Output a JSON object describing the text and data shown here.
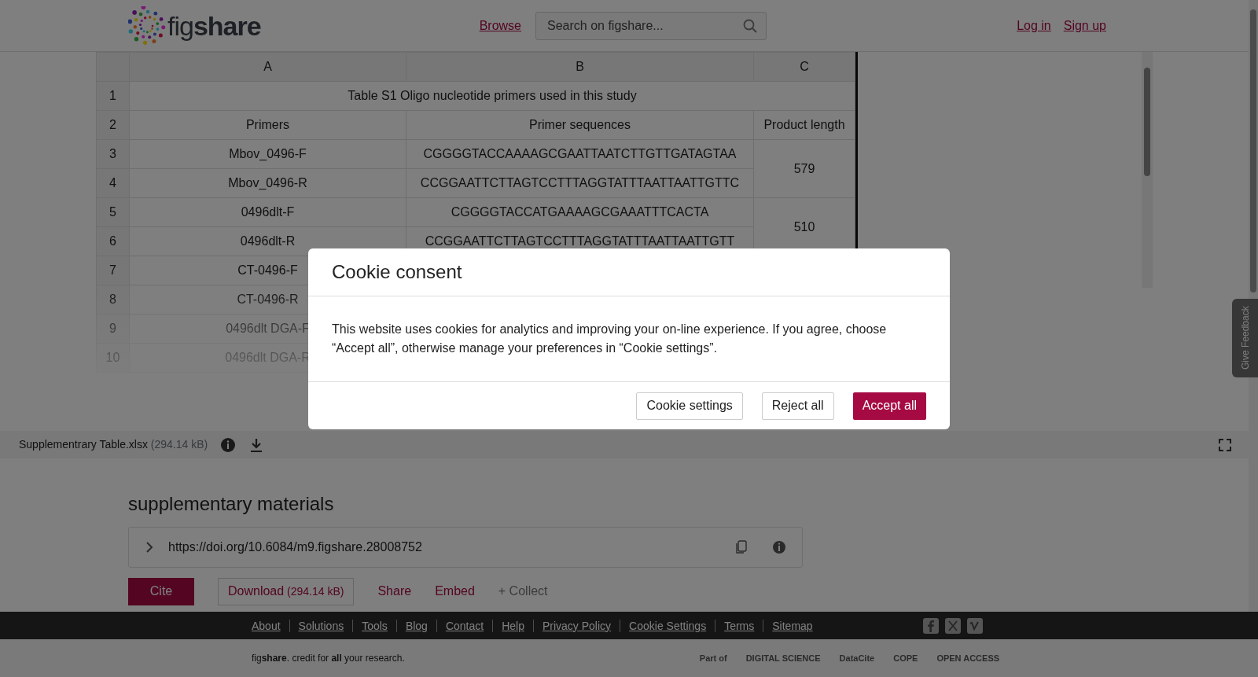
{
  "header": {
    "logo": "fig**share**",
    "nav": [
      {
        "label": "Browse"
      }
    ],
    "search": {
      "placeholder": "Search on figshare..."
    },
    "auth": [
      {
        "label": "Log in"
      },
      {
        "label": "Sign up"
      }
    ]
  },
  "viewer": {
    "columns": [
      "A",
      "B",
      "C"
    ],
    "rows": [
      {
        "number": "1",
        "cells": [
          {
            "text": "Table S1 Oligo nucleotide primers used in this study",
            "colspan": 3
          }
        ]
      },
      {
        "number": "2",
        "cells": [
          {
            "text": "Primers"
          },
          {
            "text": "Primer sequences"
          },
          {
            "text": "Product length"
          }
        ]
      },
      {
        "number": "3",
        "cells": [
          {
            "text": "Mbov_0496-F"
          },
          {
            "text": "CGGGGTACCAAAAGCGAATTAATCTTGTTGATAGTAA"
          },
          {
            "text": "579",
            "rowspan": 2
          }
        ]
      },
      {
        "number": "4",
        "cells": [
          {
            "text": "Mbov_0496-R"
          },
          {
            "text": "CCGGAATTCTTAGTCCTTTAGGTATTTAATTAATTGTTC"
          }
        ]
      },
      {
        "number": "5",
        "cells": [
          {
            "text": "0496dlt-F"
          },
          {
            "text": "CGGGGTACCATGAAAAGCGAAATTTCACTA"
          },
          {
            "text": "510",
            "rowspan": 2
          }
        ]
      },
      {
        "number": "6",
        "cells": [
          {
            "text": "0496dlt-R"
          },
          {
            "text": "CCGGAATTCTTAGTCCTTTAGGTATTTAATTAATTGTT"
          }
        ]
      },
      {
        "number": "7",
        "cells": [
          {
            "text": "CT-0496-F"
          }
        ]
      },
      {
        "number": "8",
        "cells": [
          {
            "text": "CT-0496-R"
          }
        ]
      },
      {
        "number": "9",
        "cells": [
          {
            "text": "0496dlt DGA-F"
          }
        ]
      },
      {
        "number": "10",
        "cells": [
          {
            "text": "0496dlt DGA-R"
          }
        ]
      }
    ],
    "file": {
      "name": "Supplementrary Table.xlsx",
      "size": "(294.14 kB)"
    }
  },
  "feedback": {
    "label": "Give Feedback"
  },
  "item": {
    "title": "supplementary materials",
    "doi": "https://doi.org/10.6084/m9.figshare.28008752",
    "actions": [
      {
        "kind": "primary",
        "label": "Cite"
      },
      {
        "kind": "outline",
        "label": "Download",
        "extra": "(294.14 kB)"
      },
      {
        "kind": "link",
        "label": "Share"
      },
      {
        "kind": "link",
        "label": "Embed"
      },
      {
        "kind": "muted",
        "label": "+ Collect"
      }
    ]
  },
  "footer": {
    "links": [
      "About",
      "Solutions",
      "Tools",
      "Blog",
      "Contact",
      "Help",
      "Privacy Policy",
      "Cookie Settings",
      "Terms",
      "Sitemap"
    ],
    "tagline": "fig**share**. credit for **all** your research.",
    "partners": [
      "Part of",
      "DIGITAL SCIENCE",
      "DataCite",
      "COPE",
      "OPEN ACCESS"
    ]
  },
  "modal": {
    "title": "Cookie consent",
    "body": "This website uses cookies for analytics and improving your on-line experience. If you agree, choose “Accept all”, otherwise manage your preferences in “Cookie settings”.",
    "buttons": [
      {
        "kind": "outline",
        "label": "Cookie settings"
      },
      {
        "kind": "outline",
        "label": "Reject all"
      },
      {
        "kind": "primary",
        "label": "Accept all"
      }
    ]
  }
}
